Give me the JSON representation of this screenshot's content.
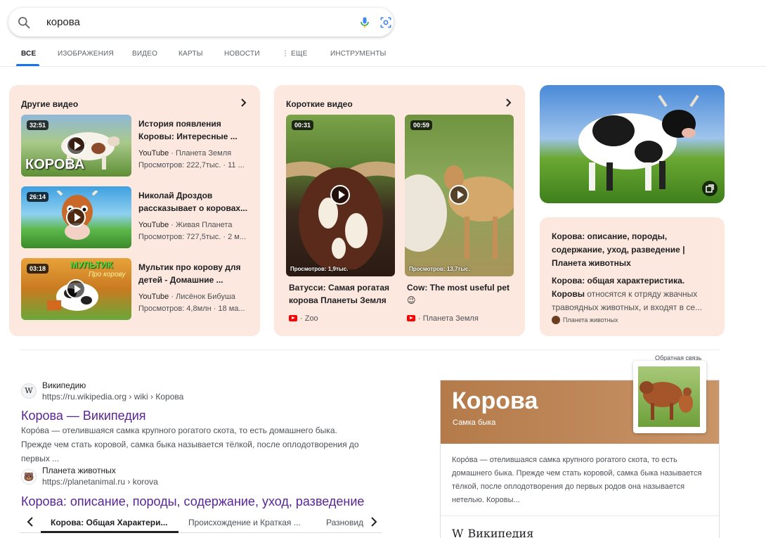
{
  "search": {
    "query": "корова",
    "icons": {
      "search": "search-icon",
      "mic": "mic-icon",
      "lens": "lens-icon"
    }
  },
  "tabs": [
    {
      "label": "ВСЕ",
      "active": true
    },
    {
      "label": "ИЗОБРАЖЕНИЯ"
    },
    {
      "label": "ВИДЕО"
    },
    {
      "label": "КАРТЫ"
    },
    {
      "label": "НОВОСТИ"
    },
    {
      "label": "⋮ ЕЩЕ"
    },
    {
      "label": "ИНСТРУМЕНТЫ"
    }
  ],
  "other_videos": {
    "title": "Другие видео",
    "items": [
      {
        "duration": "32:51",
        "thumb_text": "КОРОВА",
        "title": "История появления Коровы: Интересные ...",
        "source": "YouTube",
        "channel": "Планета Земля",
        "views": "Просмотров: 222,7тыс. · 11 ..."
      },
      {
        "duration": "26:14",
        "title": "Николай Дроздов рассказывает о коровах...",
        "source": "YouTube",
        "channel": "Живая Планета",
        "views": "Просмотров: 727,5тыс. · 2 м..."
      },
      {
        "duration": "03:18",
        "thumb_text": "МУЛЬТИК",
        "thumb_sub": "Про корову",
        "title": "Мультик про корову для детей - Домашние ...",
        "source": "YouTube",
        "channel": "Лисёнок Бибуша",
        "views": "Просмотров: 4,8млн · 18 ма..."
      }
    ]
  },
  "short_videos": {
    "title": "Короткие видео",
    "items": [
      {
        "duration": "00:31",
        "views": "Просмотров: 1,9тыс.",
        "title": "Ватусси: Самая рогатая корова Планеты Земля",
        "channel": "· Zoo"
      },
      {
        "duration": "00:59",
        "views": "Просмотров: 13,7тыс.",
        "title": "Cow: The most useful pet 😉",
        "channel": "· Планета Земля"
      }
    ]
  },
  "article_card": {
    "title": "Корова: описание, породы, содержание, уход, разведение | Планета животных",
    "snippet_1": "Корова: общая характеристика.",
    "snippet_2_bold": "Коровы",
    "snippet_2": " относятся к отряду жвачных травоядных животных, и входят в се...",
    "source": "Планета животных"
  },
  "results": [
    {
      "site": "Википедию",
      "url": "https://ru.wikipedia.org › wiki › Корова",
      "title": "Корова — Википедия",
      "snippet": "Коро́ва — отелившаяся самка крупного рогатого скота, то есть домашнего быка. Прежде чем стать коровой, самка быка называется тёлкой, после оплодотворения до первых ...",
      "favicon": "W"
    },
    {
      "site": "Планета животных",
      "url": "https://planetanimal.ru › korova",
      "title": "Корова: описание, породы, содержание, уход, разведение",
      "favicon": "🐻"
    }
  ],
  "subtabs": [
    "Корова: Общая Характери...",
    "Происхождение и Краткая ...",
    "Разновид"
  ],
  "knowledge_panel": {
    "feedback": "Обратная связь",
    "title": "Корова",
    "subtitle": "Самка быка",
    "text": "Коро́ва — отелившаяся самка крупного рогатого скота, то есть домашнего быка. Прежде чем стать коровой, самка быка называется тёлкой, после оплодотворения до первых родов она называется нетелью. Коровы...",
    "source_icon": "W",
    "source": "Википедия"
  },
  "colors": {
    "card_bg": "#fce8de",
    "link_visited": "#5a2596",
    "tab_accent": "#1a73e8",
    "kp_header": "#b47a4a"
  }
}
